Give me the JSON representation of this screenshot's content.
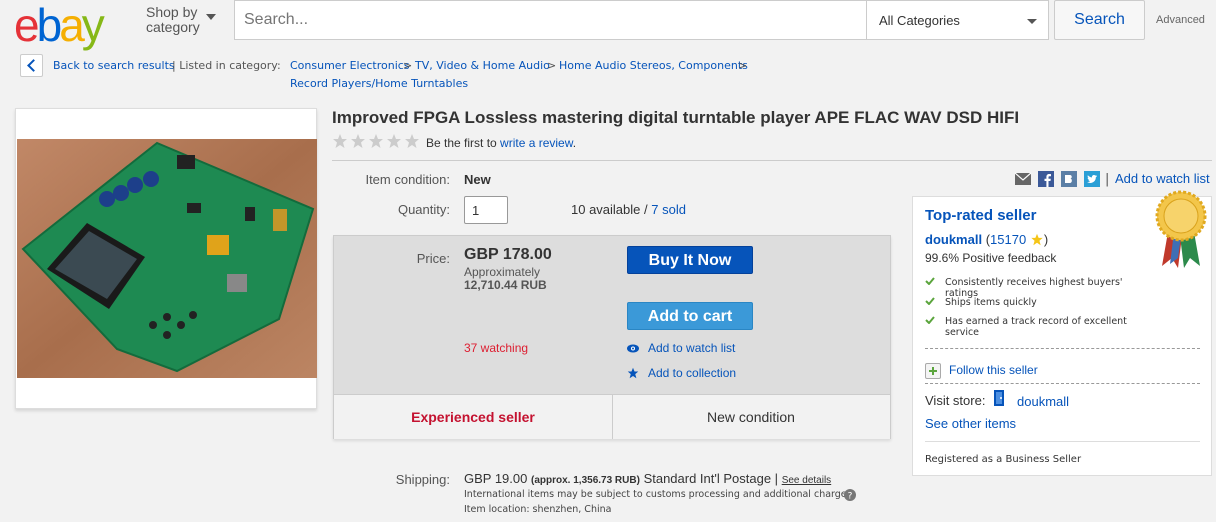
{
  "header": {
    "logo_letters": [
      "e",
      "b",
      "a",
      "y"
    ],
    "logo_colors": [
      "#e53238",
      "#0064d2",
      "#f5af02",
      "#86b817"
    ],
    "shop_by_line1": "Shop by",
    "shop_by_line2": "category",
    "search_placeholder": "Search...",
    "category_select": "All Categories",
    "search_button": "Search",
    "advanced_link": "Advanced"
  },
  "breadcrumb": {
    "back_label": "Back to search results",
    "listed_in": "| Listed in category:",
    "categories": [
      "Consumer Electronics",
      "TV, Video & Home Audio",
      "Home Audio Stereos, Components",
      "Record Players/Home Turntables"
    ],
    "separator": ">"
  },
  "listing": {
    "title": "Improved FPGA Lossless mastering digital turntable player APE FLAC WAV DSD HIFI",
    "rating_stars": 0,
    "review_prefix": "Be the first to",
    "review_link": "write a review",
    "review_suffix": ".",
    "condition_label": "Item condition:",
    "condition_value": "New",
    "quantity_label": "Quantity:",
    "quantity_value": "1",
    "available_text": "10 available /",
    "sold_link": "7 sold"
  },
  "price_box": {
    "price_label": "Price:",
    "price": "GBP 178.00",
    "approx_label": "Approximately",
    "approx_value": "12,710.44 RUB",
    "buy_now": "Buy It Now",
    "add_to_cart": "Add to cart",
    "watching": "37 watching",
    "add_to_watch": "Add to watch list",
    "add_to_collection": "Add to collection",
    "experienced_seller": "Experienced seller",
    "new_condition": "New condition"
  },
  "share_bar": {
    "icons": [
      "email-icon",
      "facebook-icon",
      "vk-icon",
      "twitter-icon"
    ],
    "watch_link": "Add to watch list"
  },
  "seller": {
    "title": "Top-rated seller",
    "name": "doukmall",
    "feedback_open": "(",
    "feedback_count": "15170",
    "feedback_close": ")",
    "positive": "99.6% Positive feedback",
    "bullets": [
      "Consistently receives highest buyers' ratings",
      "Ships items quickly",
      "Has earned a track record of excellent service"
    ],
    "follow": "Follow this seller",
    "visit_label": "Visit store:",
    "store_name": "doukmall",
    "see_other": "See other items",
    "registered": "Registered as a Business Seller"
  },
  "shipping": {
    "label": "Shipping:",
    "price": "GBP 19.00",
    "approx": "(approx. 1,356.73 RUB)",
    "method": "Standard Int'l Postage |",
    "see_details": "See details",
    "note": "International items may be subject to customs processing and additional charges.",
    "location": "Item location:  shenzhen, China"
  },
  "colors": {
    "link": "#0654ba",
    "buy_now": "#0654ba",
    "cart": "#3b99d8",
    "watching": "#dd1e31",
    "experienced": "#c41230"
  }
}
